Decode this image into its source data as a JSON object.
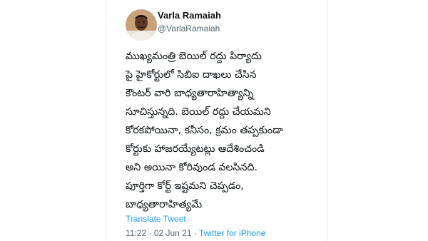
{
  "tweet": {
    "author": {
      "display_name": "Varla Ramaiah",
      "handle": "@VarlaRamaiah",
      "avatar_icon": "profile-photo"
    },
    "lines": [
      "ముఖ్యమంత్రి బెయిల్ రద్దు పిర్యాదు",
      "పై హైకోర్టులో సిబిఐ దాఖలు చేసిన",
      "కౌంటర్ వారి బాధ్యతారాహిత్యాన్ని",
      "సూచిస్తున్నది. బెయిల్ రద్దు చేయమని",
      "కోరకపోయినా, కనీసం, క్రమం తప్పకుండా",
      "కోర్టుకు హాజరయ్యేటట్లు ఆదేశించండి",
      "అని అయినా కోరివుండ వలసినది.",
      "పూర్తిగా కోర్ట్ ఇష్టమని చెప్పడం,",
      "బాధ్యతారాహిత్యమే"
    ],
    "translate_label": "Translate Tweet",
    "time": "11:22",
    "separator": "·",
    "date": "02 Jun 21",
    "source": "Twitter for iPhone",
    "colors": {
      "link": "#1d9bf0",
      "text": "#0f1419",
      "muted": "#536471"
    }
  }
}
